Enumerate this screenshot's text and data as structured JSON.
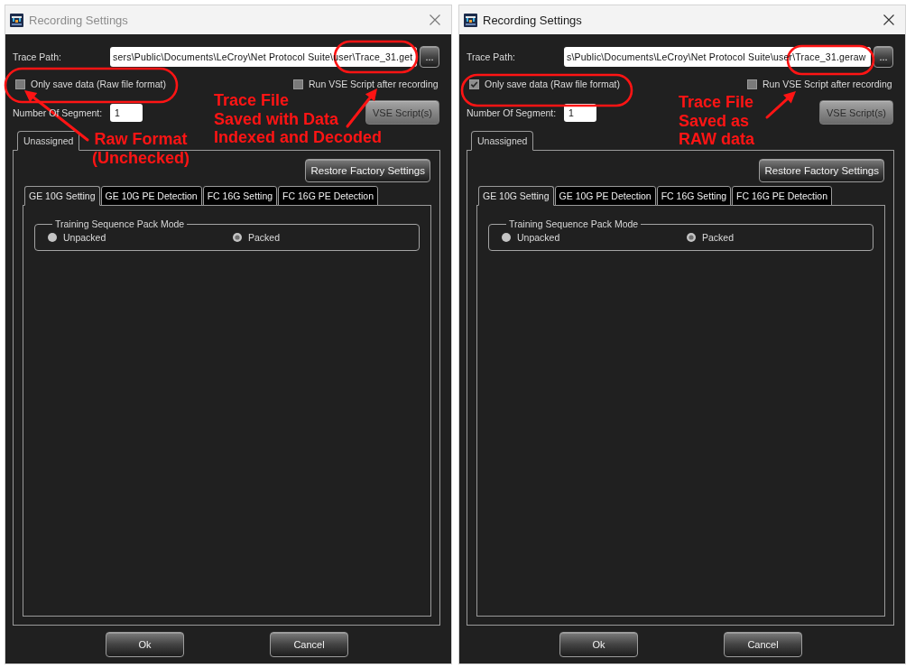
{
  "dialogs": [
    {
      "window": {
        "title": "Recording Settings",
        "active": false
      },
      "trace_path": {
        "label": "Trace Path:",
        "value": "sers\\Public\\Documents\\LeCroy\\Net Protocol Suite\\user\\Trace_31.get",
        "browse_button": "..."
      },
      "checkboxes": [
        {
          "label": "Only save data (Raw file format)",
          "checked": false
        },
        {
          "label": "Run VSE Script after recording",
          "checked": false
        }
      ],
      "segments": {
        "label": "Number Of Segment:",
        "value": "1"
      },
      "script_button": {
        "label": "VSE Script(s)",
        "disabled": true
      },
      "outer_tabs": [
        {
          "label": "Unassigned",
          "selected": true
        }
      ],
      "restore_button": "Restore Factory Settings",
      "inner_tabs": [
        {
          "label": "GE 10G Setting",
          "selected": true
        },
        {
          "label": "GE 10G PE Detection",
          "selected": false
        },
        {
          "label": "FC 16G Setting",
          "selected": false
        },
        {
          "label": "FC 16G PE Detection",
          "selected": false
        }
      ],
      "group": {
        "title": "Training Sequence Pack Mode",
        "options": [
          {
            "label": "Unpacked",
            "selected": false
          },
          {
            "label": "Packed",
            "selected": true
          }
        ]
      },
      "buttons": [
        "Ok",
        "Cancel"
      ],
      "annotations": [
        {
          "kind": "checkbox-note",
          "lines": [
            "Raw Format",
            "(Unchecked)"
          ]
        },
        {
          "kind": "path-note",
          "lines": [
            "Trace File",
            "Saved with Data",
            "Indexed and Decoded"
          ]
        }
      ]
    },
    {
      "window": {
        "title": "Recording Settings",
        "active": true
      },
      "trace_path": {
        "label": "Trace Path:",
        "value": "s\\Public\\Documents\\LeCroy\\Net Protocol Suite\\user\\Trace_31.geraw",
        "browse_button": "..."
      },
      "checkboxes": [
        {
          "label": "Only save data (Raw file format)",
          "checked": true
        },
        {
          "label": "Run VSE Script after recording",
          "checked": false
        }
      ],
      "segments": {
        "label": "Number Of Segment:",
        "value": "1"
      },
      "script_button": {
        "label": "VSE Script(s)",
        "disabled": true
      },
      "outer_tabs": [
        {
          "label": "Unassigned",
          "selected": true
        }
      ],
      "restore_button": "Restore Factory Settings",
      "inner_tabs": [
        {
          "label": "GE 10G Setting",
          "selected": true
        },
        {
          "label": "GE 10G PE Detection",
          "selected": false
        },
        {
          "label": "FC 16G Setting",
          "selected": false
        },
        {
          "label": "FC 16G PE Detection",
          "selected": false
        }
      ],
      "group": {
        "title": "Training Sequence Pack Mode",
        "options": [
          {
            "label": "Unpacked",
            "selected": false
          },
          {
            "label": "Packed",
            "selected": true
          }
        ]
      },
      "buttons": [
        "Ok",
        "Cancel"
      ],
      "annotations": [
        {
          "kind": "path-note",
          "lines": [
            "Trace File",
            "Saved as",
            "RAW data"
          ]
        }
      ]
    }
  ]
}
